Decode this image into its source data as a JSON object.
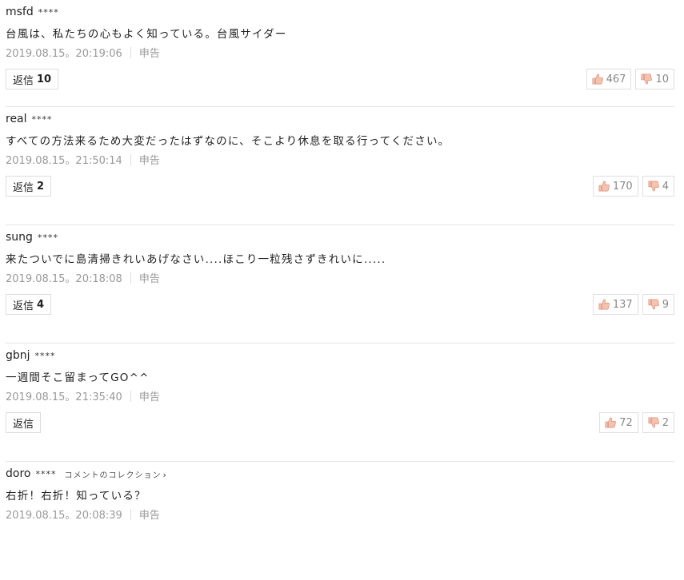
{
  "comments": [
    {
      "user": "msfd",
      "mask": "****",
      "collection": "",
      "text": "台風は、私たちの心もよく知っている。台風サイダー",
      "time": "2019.08.15。20:19:06",
      "report": "申告",
      "reply_label": "返信",
      "reply_count": "10",
      "up": "467",
      "down": "10"
    },
    {
      "user": "real",
      "mask": "****",
      "collection": "",
      "text": "すべての方法来るため大変だったはずなのに、そこより休息を取る行ってください。",
      "time": "2019.08.15。21:50:14",
      "report": "申告",
      "reply_label": "返信",
      "reply_count": "2",
      "up": "170",
      "down": "4"
    },
    {
      "user": "sung",
      "mask": "****",
      "collection": "",
      "text": "来たついでに島清掃きれいあげなさい....ほこり一粒残さずきれいに.....",
      "time": "2019.08.15。20:18:08",
      "report": "申告",
      "reply_label": "返信",
      "reply_count": "4",
      "up": "137",
      "down": "9"
    },
    {
      "user": "gbnj",
      "mask": "****",
      "collection": "",
      "text": "一週間そこ留まってGO^^",
      "time": "2019.08.15。21:35:40",
      "report": "申告",
      "reply_label": "返信",
      "reply_count": "",
      "up": "72",
      "down": "2"
    },
    {
      "user": "doro",
      "mask": "****",
      "collection": "コメントのコレクション",
      "text": "右折！右折！知っている？",
      "time": "2019.08.15。20:08:39",
      "report": "申告",
      "reply_label": "",
      "reply_count": "",
      "up": "",
      "down": ""
    }
  ],
  "colors": {
    "thumb_up": "#e8a088",
    "thumb_down": "#e8a088"
  }
}
